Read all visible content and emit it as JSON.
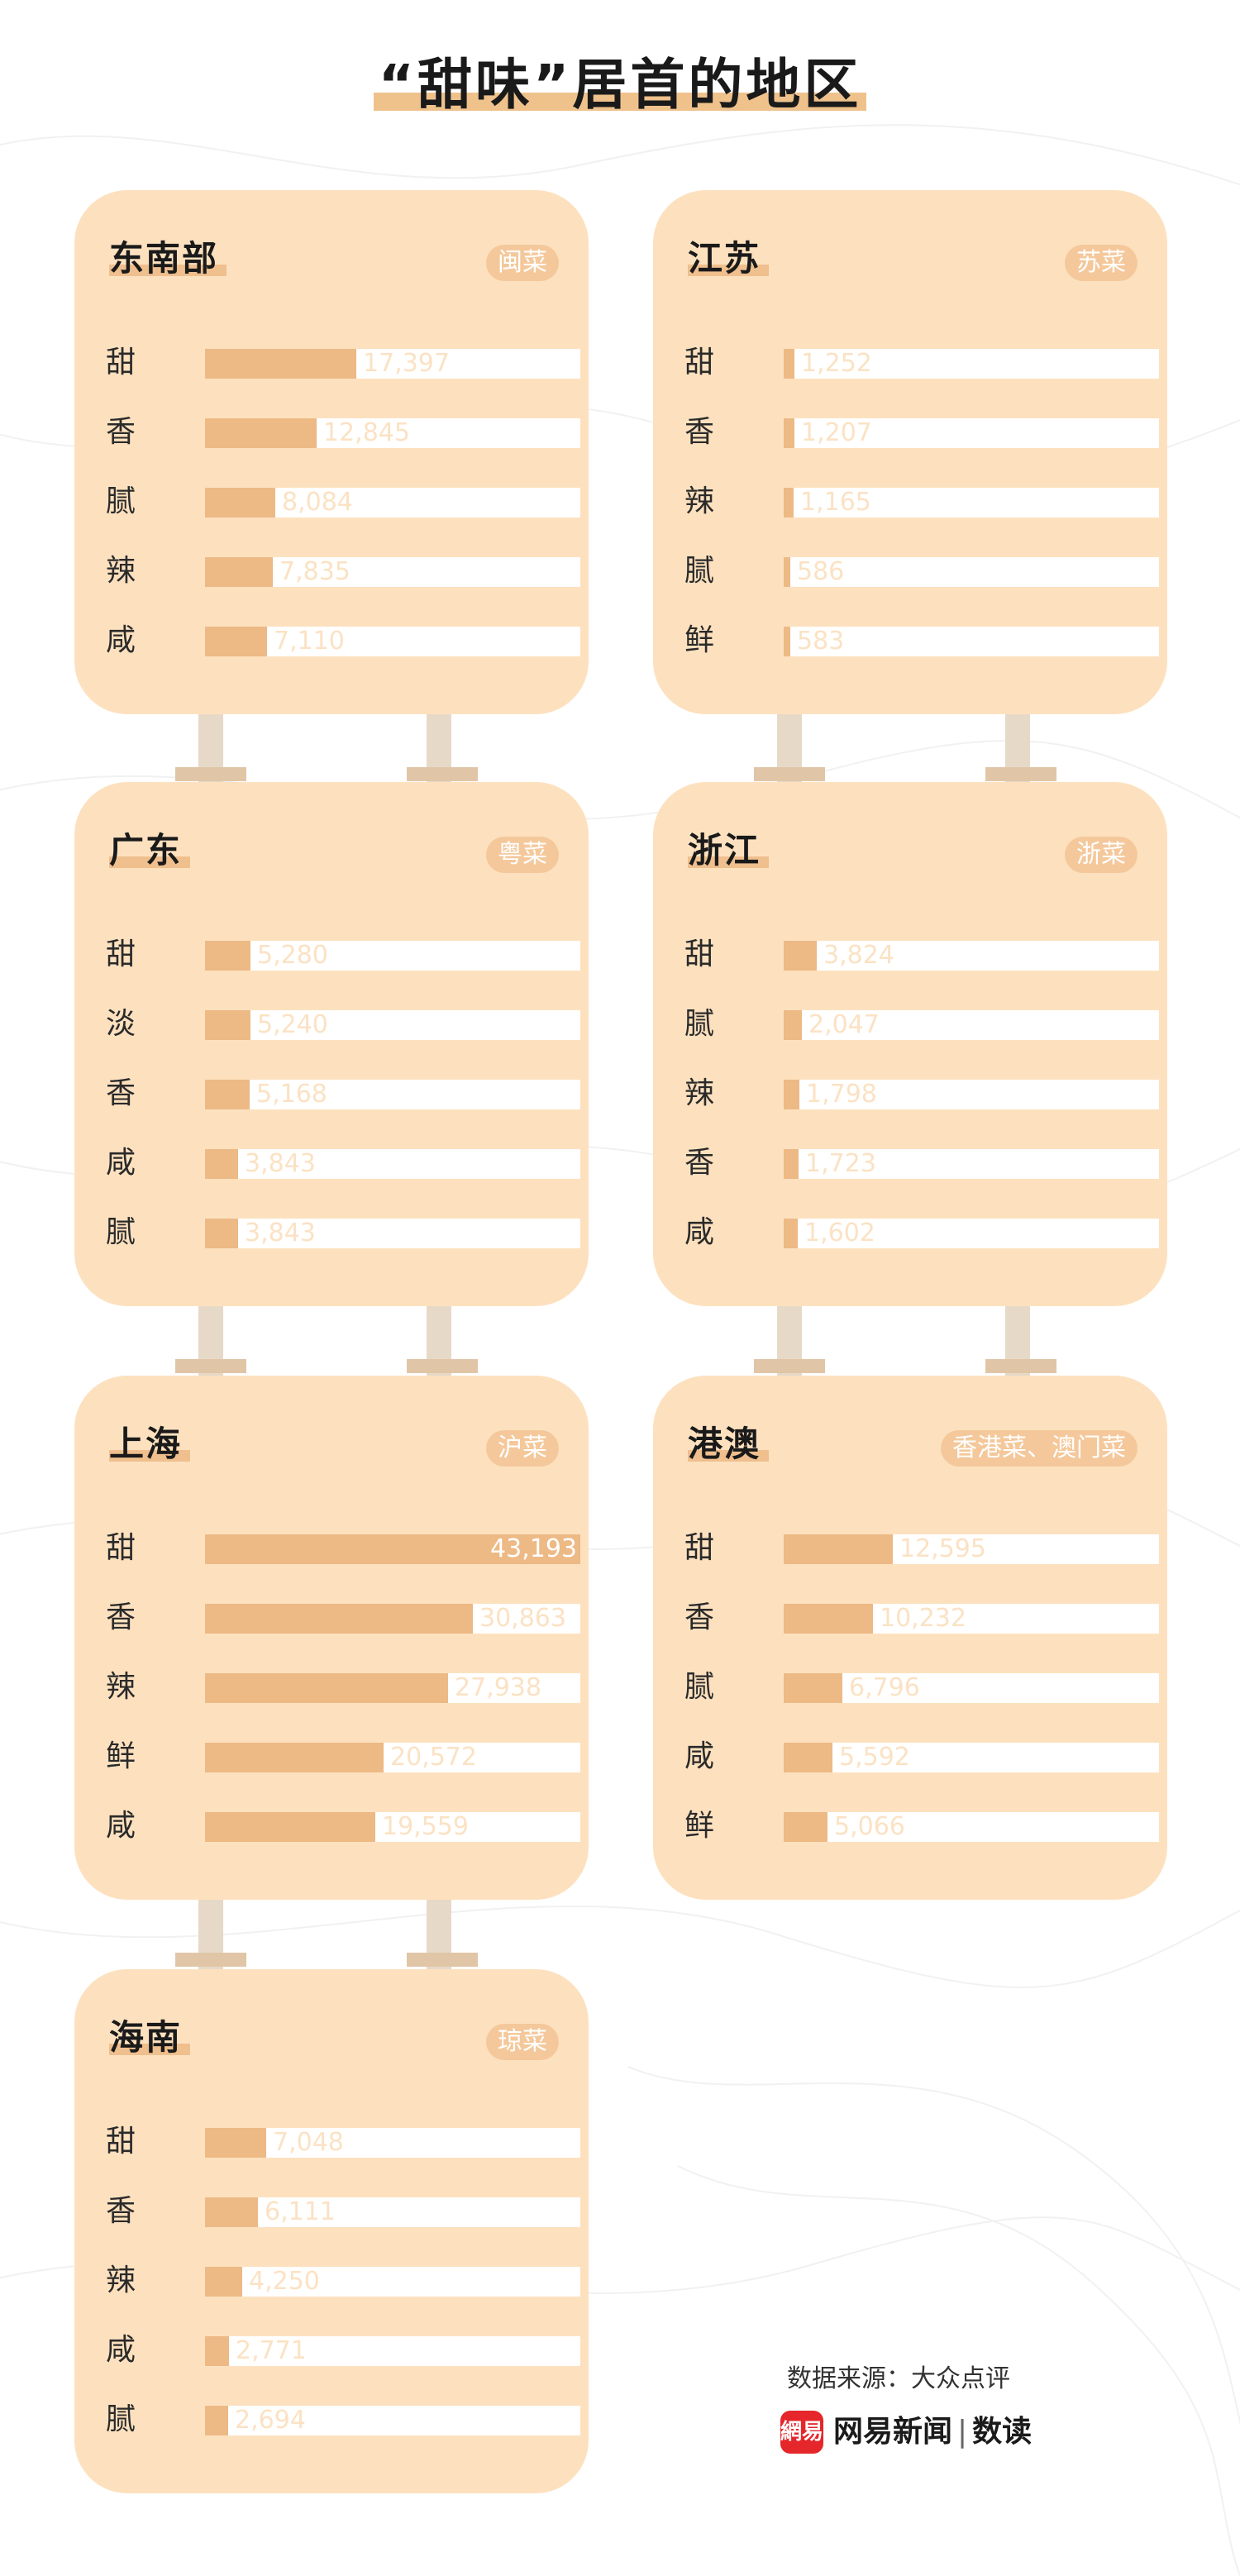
{
  "title": "“甜味”居首的地区",
  "source": "数据来源：大众点评",
  "brand": {
    "logo_text": "網易",
    "name": "网易新闻",
    "separator": "|",
    "column": "数读"
  },
  "colors": {
    "card_bg": "#fde1bf",
    "bar_fill": "#edb985",
    "bar_track": "#ffffff",
    "badge_bg": "#f4c89b",
    "title_highlight": "#efc28c"
  },
  "chart_data": [
    {
      "type": "bar",
      "orientation": "horizontal",
      "title": "东南部",
      "badge": "闽菜",
      "xlim": [
        0,
        43193
      ],
      "categories": [
        "甜",
        "香",
        "腻",
        "辣",
        "咸"
      ],
      "values": [
        17397,
        12845,
        8084,
        7835,
        7110
      ],
      "labels": [
        "17,397",
        "12,845",
        "8,084",
        "7,835",
        "7,110"
      ]
    },
    {
      "type": "bar",
      "orientation": "horizontal",
      "title": "江苏",
      "badge": "苏菜",
      "xlim": [
        0,
        43193
      ],
      "categories": [
        "甜",
        "香",
        "辣",
        "腻",
        "鲜"
      ],
      "values": [
        1252,
        1207,
        1165,
        586,
        583
      ],
      "labels": [
        "1,252",
        "1,207",
        "1,165",
        "586",
        "583"
      ]
    },
    {
      "type": "bar",
      "orientation": "horizontal",
      "title": "广东",
      "badge": "粤菜",
      "xlim": [
        0,
        43193
      ],
      "categories": [
        "甜",
        "淡",
        "香",
        "咸",
        "腻"
      ],
      "values": [
        5280,
        5240,
        5168,
        3843,
        3843
      ],
      "labels": [
        "5,280",
        "5,240",
        "5,168",
        "3,843",
        "3,843"
      ]
    },
    {
      "type": "bar",
      "orientation": "horizontal",
      "title": "浙江",
      "badge": "浙菜",
      "xlim": [
        0,
        43193
      ],
      "categories": [
        "甜",
        "腻",
        "辣",
        "香",
        "咸"
      ],
      "values": [
        3824,
        2047,
        1798,
        1723,
        1602
      ],
      "labels": [
        "3,824",
        "2,047",
        "1,798",
        "1,723",
        "1,602"
      ]
    },
    {
      "type": "bar",
      "orientation": "horizontal",
      "title": "上海",
      "badge": "沪菜",
      "xlim": [
        0,
        43193
      ],
      "categories": [
        "甜",
        "香",
        "辣",
        "鲜",
        "咸"
      ],
      "values": [
        43193,
        30863,
        27938,
        20572,
        19559
      ],
      "labels": [
        "43,193",
        "30,863",
        "27,938",
        "20,572",
        "19,559"
      ]
    },
    {
      "type": "bar",
      "orientation": "horizontal",
      "title": "港澳",
      "badge": "香港菜、澳门菜",
      "xlim": [
        0,
        43193
      ],
      "categories": [
        "甜",
        "香",
        "腻",
        "咸",
        "鲜"
      ],
      "values": [
        12595,
        10232,
        6796,
        5592,
        5066
      ],
      "labels": [
        "12,595",
        "10,232",
        "6,796",
        "5,592",
        "5,066"
      ]
    },
    {
      "type": "bar",
      "orientation": "horizontal",
      "title": "海南",
      "badge": "琼菜",
      "xlim": [
        0,
        43193
      ],
      "categories": [
        "甜",
        "香",
        "辣",
        "咸",
        "腻"
      ],
      "values": [
        7048,
        6111,
        4250,
        2771,
        2694
      ],
      "labels": [
        "7,048",
        "6,111",
        "4,250",
        "2,771",
        "2,694"
      ]
    }
  ]
}
